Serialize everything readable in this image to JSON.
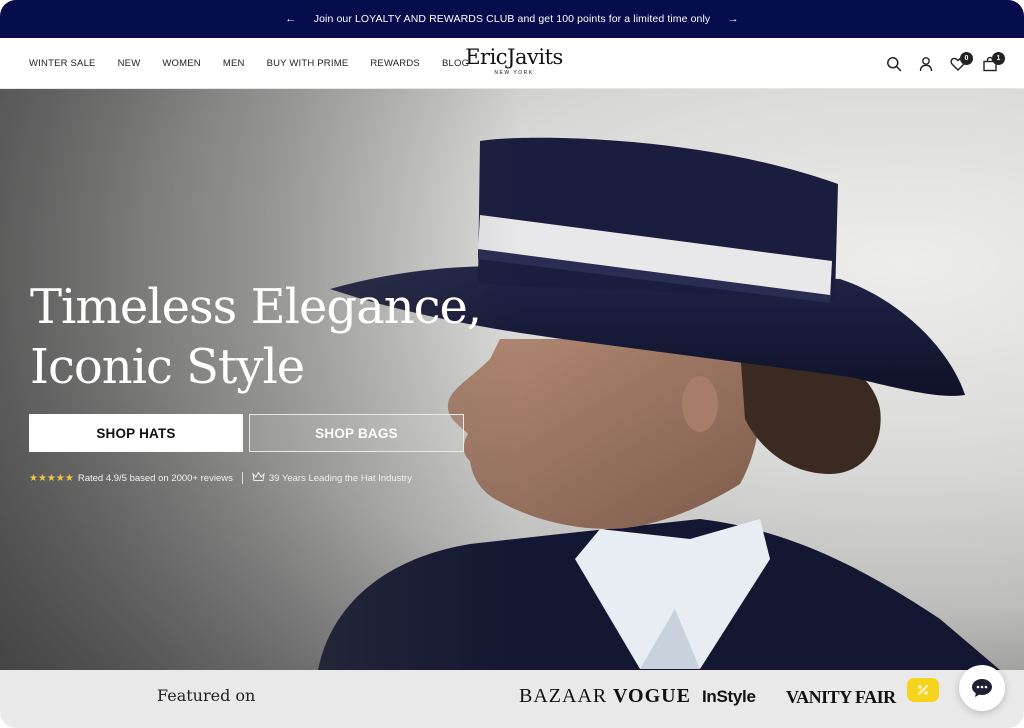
{
  "announcement": {
    "message": "Join our LOYALTY AND REWARDS CLUB and get 100 points for a limited time only",
    "prev_icon": "arrow-left-icon",
    "next_icon": "arrow-right-icon",
    "background": "#070c4c"
  },
  "nav": {
    "items": [
      "WINTER SALE",
      "NEW",
      "WOMEN",
      "MEN",
      "BUY WITH PRIME",
      "REWARDS",
      "BLOG"
    ]
  },
  "logo": {
    "name": "EricJavits",
    "sub": "NEW YORK"
  },
  "header_icons": {
    "search": "search-icon",
    "account": "user-icon",
    "wishlist": "heart-icon",
    "wishlist_count": "0",
    "cart": "bag-icon",
    "cart_count": "1"
  },
  "hero": {
    "headline_line1": "Timeless Elegance,",
    "headline_line2": "Iconic Style",
    "primary_cta": "SHOP HATS",
    "secondary_cta": "SHOP BAGS",
    "stars": "★★★★★",
    "rating_text": "Rated 4.9/5 based on 2000+ reviews",
    "years_text": "39 Years Leading the Hat Industry"
  },
  "featured": {
    "label": "Featured on",
    "brands": [
      "BAZAAR",
      "VOGUE",
      "InStyle",
      "VANITY FAIR"
    ]
  },
  "widgets": {
    "promo_icon": "percent-icon",
    "chat_icon": "chat-icon",
    "promo_color": "#f6d41d"
  }
}
